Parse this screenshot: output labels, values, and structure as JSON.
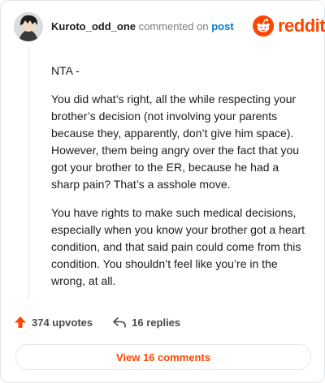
{
  "header": {
    "username": "Kuroto_odd_one",
    "action_text": " commented on ",
    "post_link": "post",
    "brand": "reddit"
  },
  "comment": {
    "paragraphs": [
      "NTA -",
      "You did what’s right, all the while respecting your brother’s decision (not involving your parents because they, apparently, don’t give him space). However, them being angry over the fact that you got your brother to the ER, because he had a sharp pain? That’s a asshole move.",
      "You have rights to make such medical decisions, especially when you know your brother got a heart condition, and that said pain could come from this condition. You shouldn’t feel like you’re in the wrong, at all."
    ]
  },
  "footer": {
    "upvotes": "374 upvotes",
    "replies": "16 replies",
    "view_comments": "View 16 comments"
  },
  "colors": {
    "accent": "#ff4500",
    "link": "#0079d3",
    "text": "#1c1c1c",
    "muted": "#7c7c7c"
  },
  "icons": {
    "upvote": "upvote-arrow-icon",
    "reply": "reply-arrow-icon",
    "brand": "reddit-alien-icon"
  }
}
